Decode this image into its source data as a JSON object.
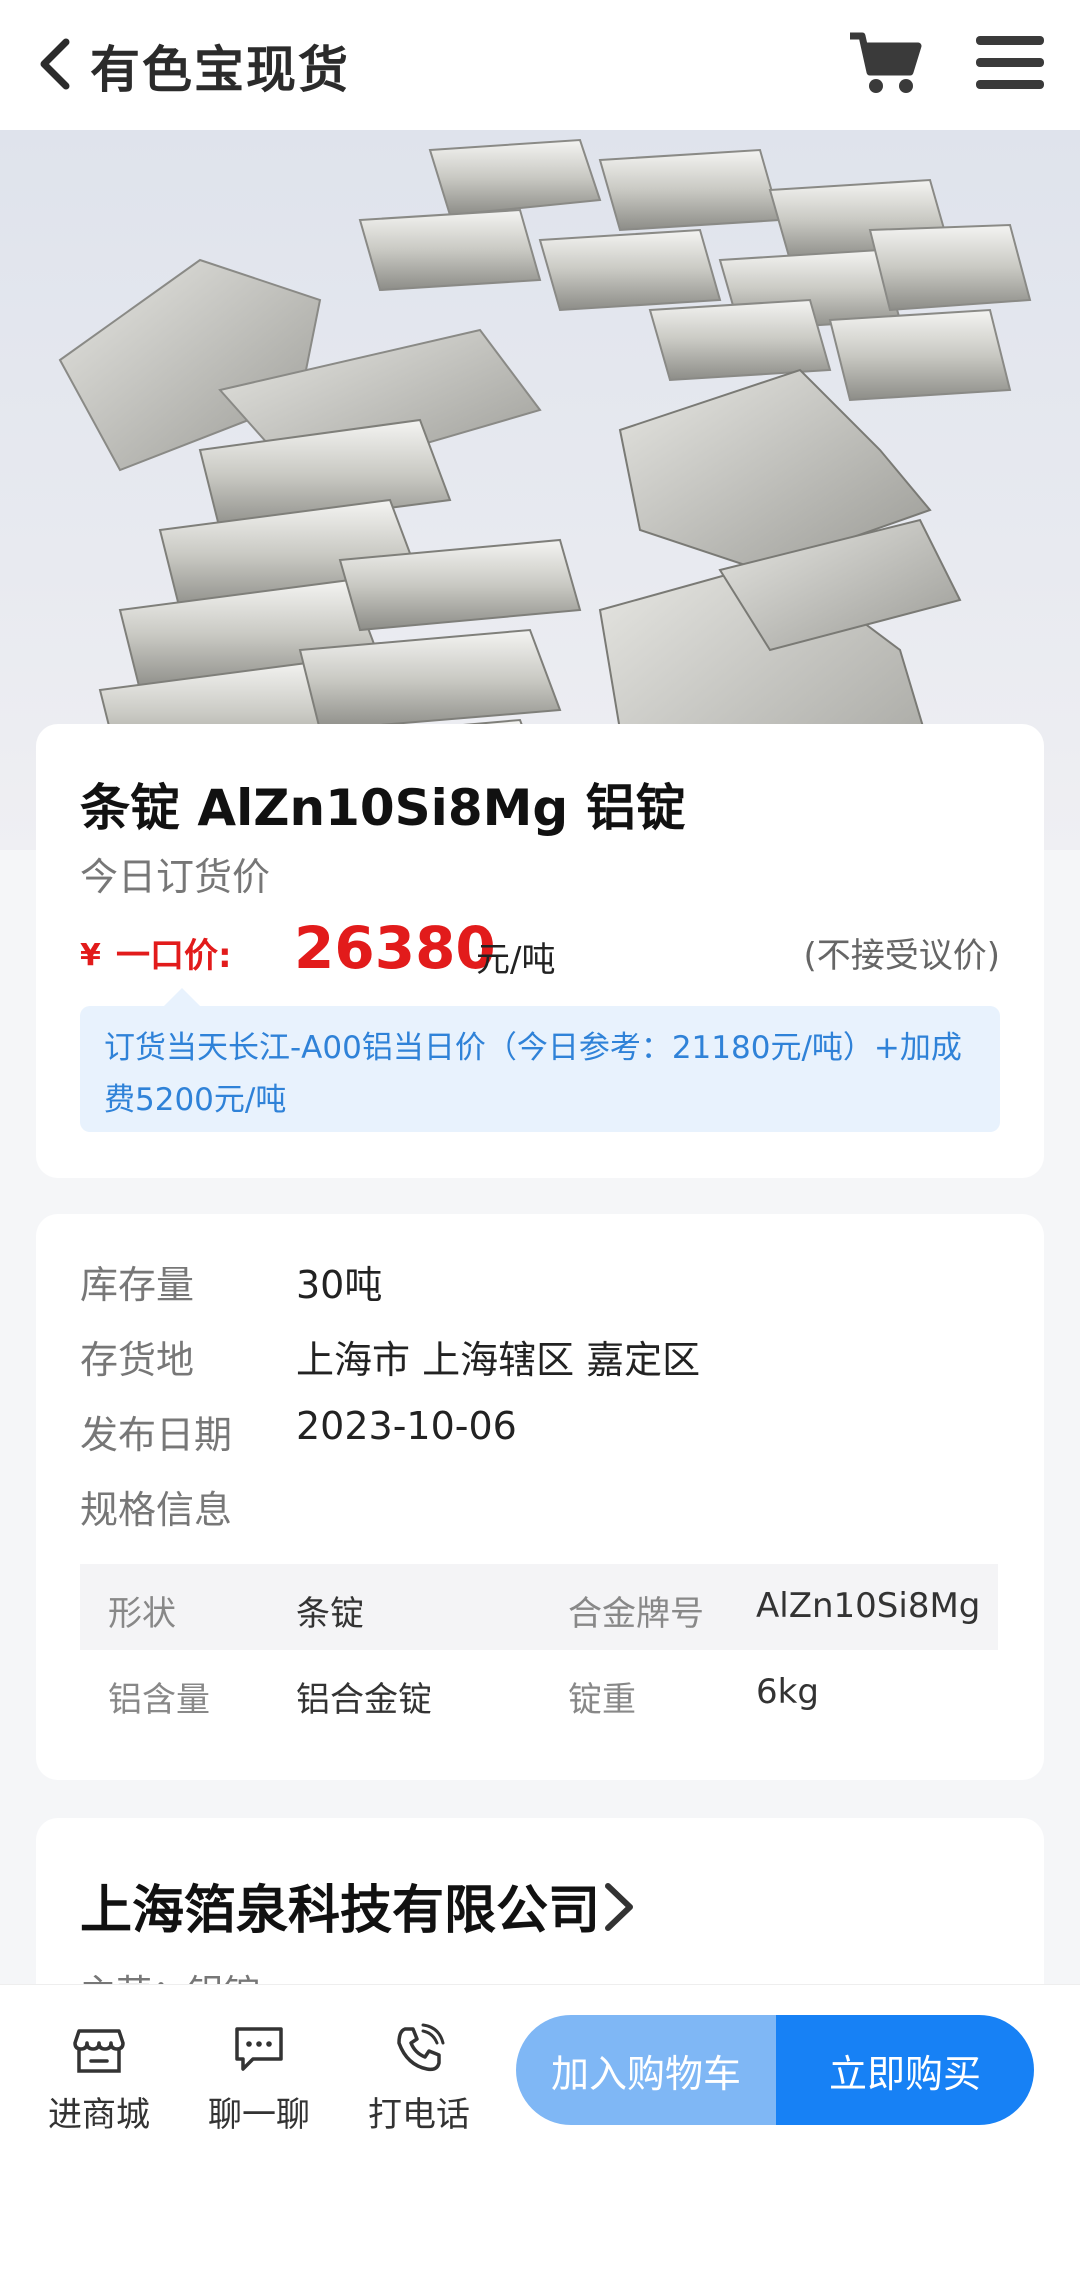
{
  "header": {
    "title": "有色宝现货",
    "back_icon": "chevron-left-icon",
    "cart_icon": "cart-icon",
    "menu_icon": "menu-icon"
  },
  "product": {
    "title": "条锭 AlZn10Si8Mg 铝锭",
    "price_subtitle": "今日订货价",
    "currency_symbol": "¥",
    "price_label": "一口价:",
    "price_value": "26380",
    "price_unit": "元/吨",
    "price_note": "(不接受议价)",
    "formula_text": "订货当天长江-A00铝当日价（今日参考：21180元/吨）+加成费5200元/吨"
  },
  "info": {
    "stock_label": "库存量",
    "stock_value": "30吨",
    "location_label": "存货地",
    "location_value": "上海市 上海辖区 嘉定区",
    "date_label": "发布日期",
    "date_value": "2023-10-06",
    "spec_label": "规格信息",
    "spec_rows": [
      {
        "k1": "形状",
        "v1": "条锭",
        "k2": "合金牌号",
        "v2": "AlZn10Si8Mg"
      },
      {
        "k1": "铝含量",
        "v1": "铝合金锭",
        "k2": "锭重",
        "v2": "6kg"
      }
    ]
  },
  "company": {
    "name": "上海箔泉科技有限公司",
    "main_business": "主营：铝锭"
  },
  "bottom_bar": {
    "nav": [
      {
        "label": "进商城",
        "icon": "store-icon"
      },
      {
        "label": "聊一聊",
        "icon": "chat-icon"
      },
      {
        "label": "打电话",
        "icon": "phone-icon"
      }
    ],
    "add_to_cart": "加入购物车",
    "buy_now": "立即购买"
  },
  "colors": {
    "price_red": "#e21b1b",
    "primary_blue": "#1781f5",
    "light_blue": "#7fb7f5",
    "formula_bg": "#e8f2fd",
    "formula_text": "#2f82d8"
  }
}
